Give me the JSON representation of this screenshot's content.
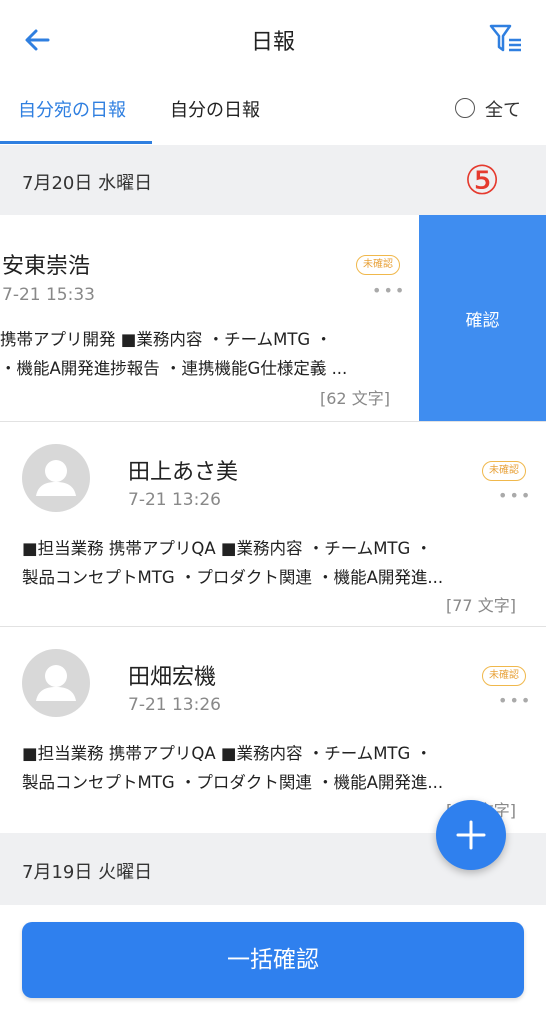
{
  "header": {
    "title": "日報",
    "back_icon": "arrow-left-icon",
    "filter_icon": "filter-list-icon"
  },
  "tabs": [
    {
      "label": "自分宛の日報",
      "active": true
    },
    {
      "label": "自分の日報",
      "active": false
    }
  ],
  "all_toggle": {
    "label": "全て",
    "checked": false
  },
  "annotation": "⑤",
  "groups": [
    {
      "date": "7月20日 水曜日"
    },
    {
      "date": "7月19日 火曜日"
    }
  ],
  "reports": [
    {
      "name": "安東崇浩",
      "time": "7-21 15:33",
      "badge": "未確認",
      "line1": "携帯アプリ開発 ■業務内容 ・チームMTG ・",
      "line2": "・機能A開発進捗報告 ・連携機能G仕様定義 ...",
      "count": "[62 文字]"
    },
    {
      "name": "田上あさ美",
      "time": "7-21 13:26",
      "badge": "未確認",
      "line1": "■担当業務 携帯アプリQA ■業務内容 ・チームMTG ・",
      "line2": "製品コンセプトMTG ・プロダクト関連 ・機能A開発進...",
      "count": "[77 文字]"
    },
    {
      "name": "田畑宏機",
      "time": "7-21 13:26",
      "badge": "未確認",
      "line1": "■担当業務 携帯アプリQA ■業務内容 ・チームMTG ・",
      "line2": "製品コンセプトMTG ・プロダクト関連 ・機能A開発進...",
      "count": "[77 文字]"
    }
  ],
  "swipe_action": {
    "label": "確認"
  },
  "fab": {
    "icon": "plus-icon"
  },
  "bulk_button": {
    "label": "一括確認"
  },
  "colors": {
    "accent": "#2f80ee",
    "badge": "#e8a23a",
    "annotation": "#e53a2e"
  }
}
